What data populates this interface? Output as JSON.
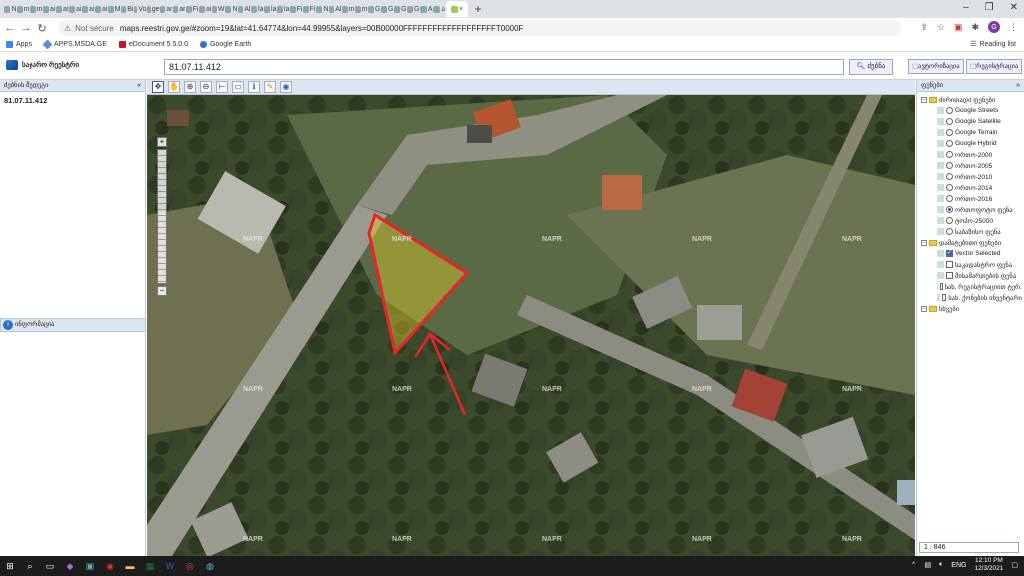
{
  "browser": {
    "tab_letters": [
      "N",
      "m",
      "m",
      "ai",
      "ai",
      "ai",
      "ai",
      "ai",
      "M",
      "Bi",
      "Vo",
      "ge",
      "ar",
      "ar",
      "Fi",
      "ai",
      "W",
      "N",
      "Al",
      "la",
      "la",
      "la",
      "Fi",
      "Fi",
      "N",
      "Al",
      "m",
      "m",
      "G",
      "G",
      "G",
      "G",
      "A",
      "ა"
    ],
    "active_tab": "×",
    "new_tab": "+",
    "not_secure": "Not secure",
    "url": "maps.reestri.gov.ge/#zoom=19&lat=41.64774&lon=44.99955&layers=00B00000FFFFFFFFFFFFFFFFFFFT0000F",
    "avatar_letter": "G",
    "bookmarks": [
      "Apps",
      "APPS.MSDA.GE",
      "eDocument 5.5.0.0",
      "Google Earth"
    ],
    "reading_list": "Reading list"
  },
  "app": {
    "logo_text": "საჯარო რეესტრი",
    "search_value": "81.07.11.412",
    "search_button": "ძებნა",
    "header_btn_1": "ავტორიზაცია",
    "header_btn_2": "რეგისტრაცია",
    "left_panel_title": "ძებნის შედეგი",
    "left_result": "81.07.11.412",
    "info_title": "ინფორმაცია",
    "right_panel_title": "ფენები",
    "scale": "1 : 846",
    "watermark": "NAPR"
  },
  "layers": [
    {
      "type": "folder",
      "label": "ძირითადი ფენები",
      "level": 1
    },
    {
      "type": "item",
      "label": "Google Streets",
      "level": 2,
      "control": "radio",
      "on": false
    },
    {
      "type": "item",
      "label": "Google Satellite",
      "level": 2,
      "control": "radio",
      "on": false
    },
    {
      "type": "item",
      "label": "Google Terrain",
      "level": 2,
      "control": "radio",
      "on": false
    },
    {
      "type": "item",
      "label": "Google Hybrid",
      "level": 2,
      "control": "radio",
      "on": false
    },
    {
      "type": "item",
      "label": "ორთო-2000",
      "level": 2,
      "control": "radio",
      "on": false
    },
    {
      "type": "item",
      "label": "ორთო-2005",
      "level": 2,
      "control": "radio",
      "on": false
    },
    {
      "type": "item",
      "label": "ორთო-2010",
      "level": 2,
      "control": "radio",
      "on": false
    },
    {
      "type": "item",
      "label": "ორთო-2014",
      "level": 2,
      "control": "radio",
      "on": false
    },
    {
      "type": "item",
      "label": "ორთო-2016",
      "level": 2,
      "control": "radio",
      "on": false
    },
    {
      "type": "item",
      "label": "ორთოფოტო ფენა",
      "level": 2,
      "control": "radio",
      "on": true
    },
    {
      "type": "item",
      "label": "ტოპო-25000",
      "level": 2,
      "control": "radio",
      "on": false
    },
    {
      "type": "item",
      "label": "საბაზისო ფენა",
      "level": 2,
      "control": "radio",
      "on": false
    },
    {
      "type": "folder",
      "label": "დამატებითი ფენები",
      "level": 1
    },
    {
      "type": "item",
      "label": "Vector Selected",
      "level": 2,
      "control": "check",
      "on": true
    },
    {
      "type": "item",
      "label": "საკადასტრო ფენა",
      "level": 2,
      "control": "check",
      "on": false
    },
    {
      "type": "item",
      "label": "მისამართების ფენა",
      "level": 2,
      "control": "check",
      "on": false
    },
    {
      "type": "item",
      "label": "სახ. რეგისტრაციით ტერ.",
      "level": 2,
      "control": "check",
      "on": false
    },
    {
      "type": "item",
      "label": "სახ. ქონების ინვენტარი",
      "level": 2,
      "control": "check",
      "on": false
    },
    {
      "type": "folder",
      "label": "სხვები",
      "level": 1
    }
  ],
  "taskbar": {
    "lang": "ENG",
    "time": "12:10 PM",
    "date": "12/3/2021"
  }
}
